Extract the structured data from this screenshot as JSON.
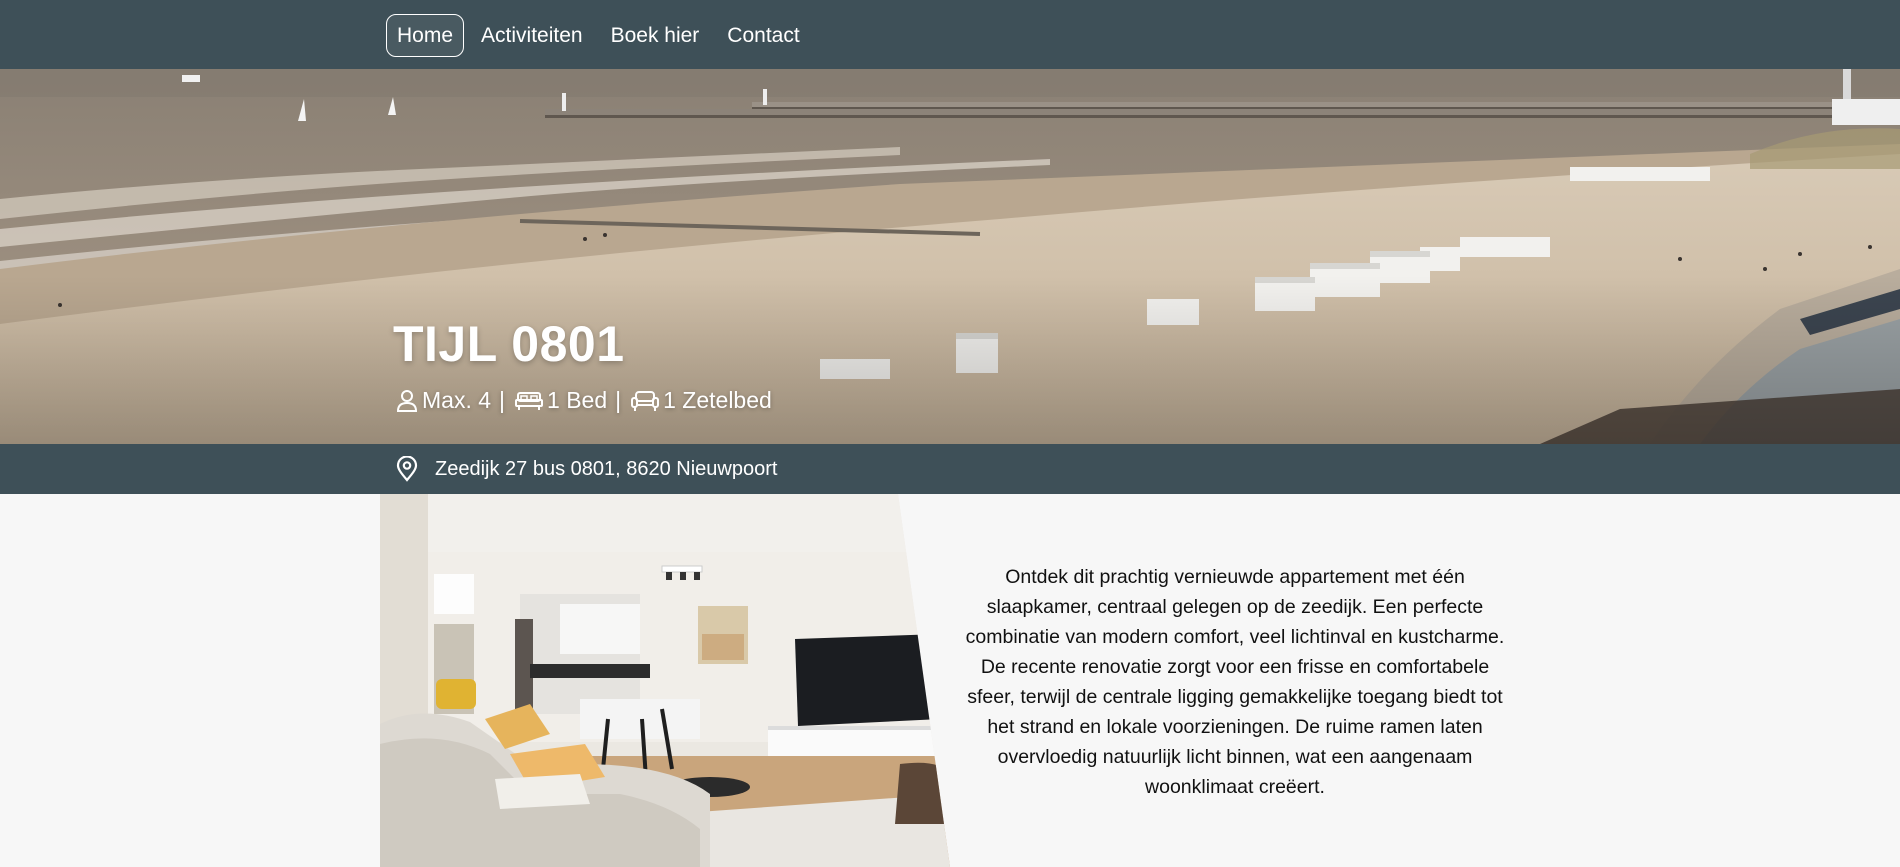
{
  "nav": {
    "items": [
      {
        "label": "Home",
        "active": true
      },
      {
        "label": "Activiteiten",
        "active": false
      },
      {
        "label": "Boek hier",
        "active": false
      },
      {
        "label": "Contact",
        "active": false
      }
    ]
  },
  "hero": {
    "title": "TIJL 0801",
    "features": [
      {
        "icon": "person-icon",
        "text": "Max. 4"
      },
      {
        "icon": "bed-icon",
        "text": "1 Bed"
      },
      {
        "icon": "sofa-icon",
        "text": "1 Zetelbed"
      }
    ],
    "separator": "|"
  },
  "address": {
    "icon": "location-pin-icon",
    "text": "Zeedijk 27 bus 0801, 8620 Nieuwpoort"
  },
  "description": {
    "text": "Ontdek dit prachtig vernieuwde appartement met één slaapkamer, centraal gelegen op de zeedijk. Een perfecte combinatie van modern comfort, veel lichtinval en kustcharme. De recente renovatie zorgt voor een frisse en comfortabele sfeer, terwijl de centrale ligging gemakkelijke toegang biedt tot het strand en lokale voorzieningen. De ruime ramen laten overvloedig natuurlijk licht binnen, wat een aangenaam woonklimaat creëert."
  },
  "colors": {
    "nav_bg": "#3e5058",
    "text_light": "#ffffff",
    "page_bg": "#f7f7f7"
  }
}
